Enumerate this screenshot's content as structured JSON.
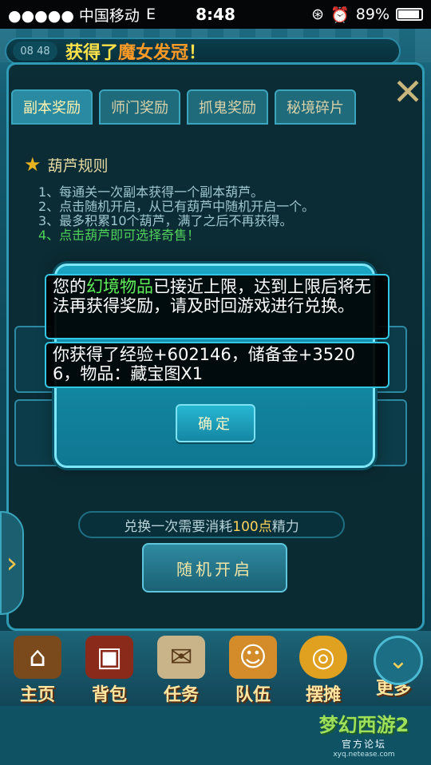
{
  "status_bar": {
    "carrier": "●●●●● 中国移动",
    "network": "E",
    "time": "8:48",
    "battery": "89%",
    "icons": [
      "rotation-lock-icon",
      "alarm-icon",
      "battery-icon"
    ]
  },
  "chat": {
    "time": "08 48",
    "message_prefix": "获得了",
    "message_item": "魔女发冠",
    "message_suffix": "！"
  },
  "tabs": [
    {
      "label": "副本奖励",
      "active": true
    },
    {
      "label": "师门奖励",
      "active": false
    },
    {
      "label": "抓鬼奖励",
      "active": false
    },
    {
      "label": "秘境碎片",
      "active": false
    }
  ],
  "rules": {
    "title": "葫芦规则",
    "lines": [
      "1、每通关一次副本获得一个副本葫芦。",
      "2、点击随机开启，从已有葫芦中随机开启一个。",
      "3、最多积累10个葫芦，满了之后不再获得。",
      "4、点击葫芦即可选择奇售！"
    ]
  },
  "exchange": {
    "prefix": "兑换一次需要消耗",
    "amount": "100点",
    "suffix": "精力",
    "random_open_label": "随机开启"
  },
  "dock": [
    {
      "label": "主页",
      "icon": "house-icon"
    },
    {
      "label": "背包",
      "icon": "chest-icon"
    },
    {
      "label": "任务",
      "icon": "scroll-icon"
    },
    {
      "label": "队伍",
      "icon": "team-icon"
    },
    {
      "label": "摆摊",
      "icon": "coin-icon"
    },
    {
      "label": "更多",
      "icon": "chevron-down-icon"
    }
  ],
  "dialog": {
    "message1_a": "您的",
    "message1_highlight": "幻境物品",
    "message1_b": "已接近上限，达到上限后将无法再获得奖励，请及时回游戏进行兑换。",
    "message2": "你获得了经验+602146，储备金+35206，物品：藏宝图X1",
    "confirm_label": "确定"
  },
  "forum_logo": {
    "title": "梦幻西游2",
    "subtitle": "官方论坛",
    "url": "xyq.netease.com"
  },
  "colors": {
    "accent": "#33c6e4",
    "highlight_green": "#5ff05a",
    "chat_gold": "#ffe24a"
  }
}
